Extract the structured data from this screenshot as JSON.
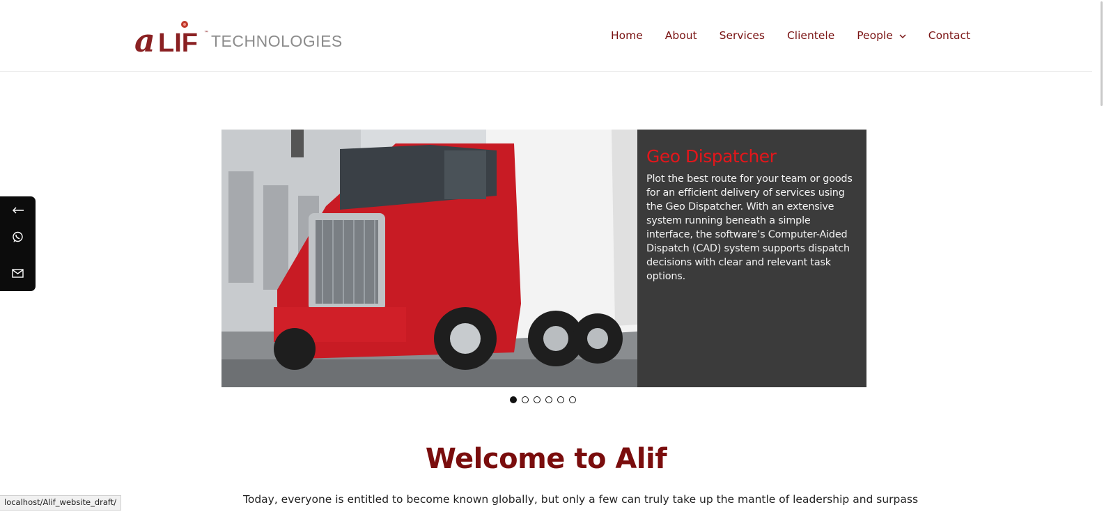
{
  "brand": {
    "logo_text": "ALIF",
    "logo_subtext": "TECHNOLOGIES",
    "logo_tm": "™",
    "accent_color": "#7a1414"
  },
  "nav": {
    "items": [
      {
        "label": "Home"
      },
      {
        "label": "About"
      },
      {
        "label": "Services"
      },
      {
        "label": "Clientele"
      },
      {
        "label": "People",
        "has_dropdown": true
      },
      {
        "label": "Contact"
      }
    ]
  },
  "slider": {
    "title": "Geo Dispatcher",
    "body": "Plot the best route for your  team or goods for an efficient delivery of services using the Geo Dispatcher. With  an extensive system running beneath a simple interface, the software’s Computer-Aided Dispatch (CAD) system supports dispatch decisions with clear and relevant task options.",
    "dots": 6,
    "active_dot": 0,
    "title_color": "#e3161b",
    "panel_color": "#3b3b3b"
  },
  "side_actions": [
    {
      "icon": "arrow-left-icon"
    },
    {
      "icon": "whatsapp-icon"
    },
    {
      "icon": "mail-icon"
    }
  ],
  "welcome": {
    "heading": "Welcome to Alif",
    "intro": "Today, everyone is entitled to become known globally, but only a few can truly take up the mantle of leadership and surpass"
  },
  "status_bar": {
    "url": "localhost/Alif_website_draft/"
  }
}
